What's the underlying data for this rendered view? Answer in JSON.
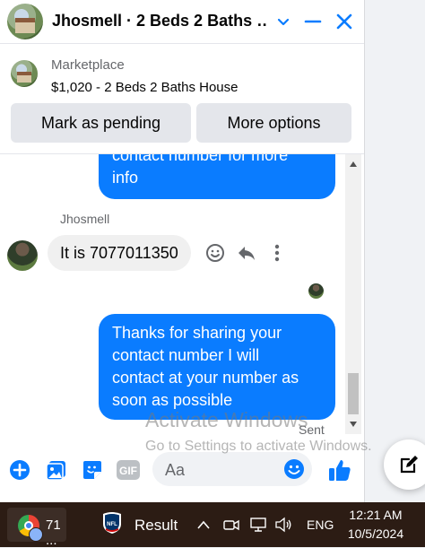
{
  "header": {
    "title": "Jhosmell · 2 Beds 2 Baths …",
    "avatar_icon": "house-thumbnail",
    "buttons": [
      "chevron-down-icon",
      "minimize-icon",
      "close-icon"
    ],
    "accent": "#0a7cff"
  },
  "marketplace": {
    "label": "Marketplace",
    "listing": "$1,020 - 2 Beds 2 Baths House",
    "mark_pending_label": "Mark as pending",
    "more_options_label": "More options"
  },
  "messages": {
    "outgoing_partial": [
      "contact number for more",
      "info"
    ],
    "sender_name": "Jhosmell",
    "incoming_text": "It is 7077011350",
    "outgoing_last": [
      "Thanks for sharing your",
      "contact number I will",
      "contact at your number as",
      "soon as possible"
    ],
    "sent_status": "Sent",
    "bubble_color": "#0a7cff"
  },
  "watermark": {
    "title": "Activate Windows",
    "subtitle": "Go to Settings to activate Windows."
  },
  "composer": {
    "placeholder": "Aa",
    "icons": [
      "plus-circle-icon",
      "photo-icon",
      "sticker-icon",
      "gif-icon",
      "emoji-icon",
      "thumbs-up-icon"
    ]
  },
  "taskbar": {
    "chrome_label": "71 ...",
    "app_label": "Result",
    "language": "ENG",
    "time": "12:21 AM",
    "date": "10/5/2024",
    "background": "#2c1c14"
  }
}
